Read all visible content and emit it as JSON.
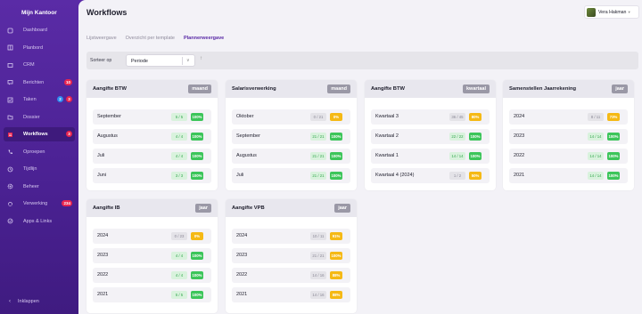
{
  "app": {
    "brand": "Mijn Kantoor",
    "page_title": "Workflows"
  },
  "user": {
    "name": "Vera Hakman"
  },
  "sidebar": {
    "items": [
      {
        "label": "Dashboard",
        "icon": "home-icon"
      },
      {
        "label": "Planbord",
        "icon": "board-icon"
      },
      {
        "label": "CRM",
        "icon": "crm-icon"
      },
      {
        "label": "Berichten",
        "icon": "message-icon",
        "badge": "10"
      },
      {
        "label": "Taken",
        "icon": "tasks-icon",
        "badge": "3",
        "badge2": "2"
      },
      {
        "label": "Dossier",
        "icon": "folder-icon"
      },
      {
        "label": "Workflows",
        "icon": "workflow-icon",
        "badge": "3",
        "active": true
      },
      {
        "label": "Oproepen",
        "icon": "phone-icon"
      },
      {
        "label": "Tijdlijn",
        "icon": "timeline-icon"
      },
      {
        "label": "Beheer",
        "icon": "gear-icon"
      },
      {
        "label": "Verwerking",
        "icon": "process-icon",
        "badge": "234"
      },
      {
        "label": "Apps & Links",
        "icon": "apps-icon"
      }
    ],
    "collapse_label": "Inklappen"
  },
  "tabs": [
    {
      "label": "Lijstweergave"
    },
    {
      "label": "Overzicht per template"
    },
    {
      "label": "Plannerweergave",
      "active": true
    }
  ],
  "sort": {
    "label": "Sorteer op",
    "value": "Periode"
  },
  "colors": {
    "sidebar": "#5a2ba6",
    "green": "#3cc55a",
    "yellow": "#f5b915",
    "accent": "#5a2ba6"
  },
  "cards": [
    {
      "title": "Aangifte BTW",
      "tag": "maand",
      "rows": [
        {
          "label": "September",
          "count": "5 / 5",
          "pct": "100%",
          "status": "green"
        },
        {
          "label": "Augustus",
          "count": "4 / 4",
          "pct": "100%",
          "status": "green"
        },
        {
          "label": "Juli",
          "count": "4 / 4",
          "pct": "100%",
          "status": "green"
        },
        {
          "label": "Juni",
          "count": "3 / 3",
          "pct": "100%",
          "status": "green"
        }
      ]
    },
    {
      "title": "Salarisverwerking",
      "tag": "maand",
      "rows": [
        {
          "label": "Oktober",
          "count": "0 / 21",
          "pct": "0%",
          "status": "yellow"
        },
        {
          "label": "September",
          "count": "21 / 21",
          "pct": "100%",
          "status": "green"
        },
        {
          "label": "Augustus",
          "count": "21 / 21",
          "pct": "100%",
          "status": "green"
        },
        {
          "label": "Juli",
          "count": "21 / 21",
          "pct": "100%",
          "status": "green"
        }
      ]
    },
    {
      "title": "Aangifte BTW",
      "tag": "kwartaal",
      "rows": [
        {
          "label": "Kwartaal 3",
          "count": "36 / 45",
          "pct": "80%",
          "status": "yellow"
        },
        {
          "label": "Kwartaal 2",
          "count": "22 / 22",
          "pct": "100%",
          "status": "green"
        },
        {
          "label": "Kwartaal 1",
          "count": "14 / 14",
          "pct": "100%",
          "status": "green"
        },
        {
          "label": "Kwartaal 4 (2024)",
          "count": "1 / 2",
          "pct": "50%",
          "status": "yellow"
        }
      ]
    },
    {
      "title": "Samenstellen Jaarrekening",
      "tag": "jaar",
      "rows": [
        {
          "label": "2024",
          "count": "8 / 11",
          "pct": "73%",
          "status": "yellow"
        },
        {
          "label": "2023",
          "count": "14 / 14",
          "pct": "100%",
          "status": "green"
        },
        {
          "label": "2022",
          "count": "14 / 14",
          "pct": "100%",
          "status": "green"
        },
        {
          "label": "2021",
          "count": "14 / 14",
          "pct": "100%",
          "status": "green"
        }
      ]
    },
    {
      "title": "Aangifte IB",
      "tag": "jaar",
      "rows": [
        {
          "label": "2024",
          "count": "0 / 23",
          "pct": "0%",
          "status": "yellow"
        },
        {
          "label": "2023",
          "count": "4 / 4",
          "pct": "100%",
          "status": "green"
        },
        {
          "label": "2022",
          "count": "4 / 4",
          "pct": "100%",
          "status": "green"
        },
        {
          "label": "2021",
          "count": "5 / 5",
          "pct": "100%",
          "status": "green"
        }
      ]
    },
    {
      "title": "Aangifte VPB",
      "tag": "jaar",
      "rows": [
        {
          "label": "2024",
          "count": "10 / 11",
          "pct": "91%",
          "status": "yellow"
        },
        {
          "label": "2023",
          "count": "21 / 21",
          "pct": "100%",
          "status": "yellow"
        },
        {
          "label": "2022",
          "count": "14 / 16",
          "pct": "88%",
          "status": "yellow"
        },
        {
          "label": "2021",
          "count": "14 / 16",
          "pct": "88%",
          "status": "yellow"
        }
      ]
    }
  ]
}
